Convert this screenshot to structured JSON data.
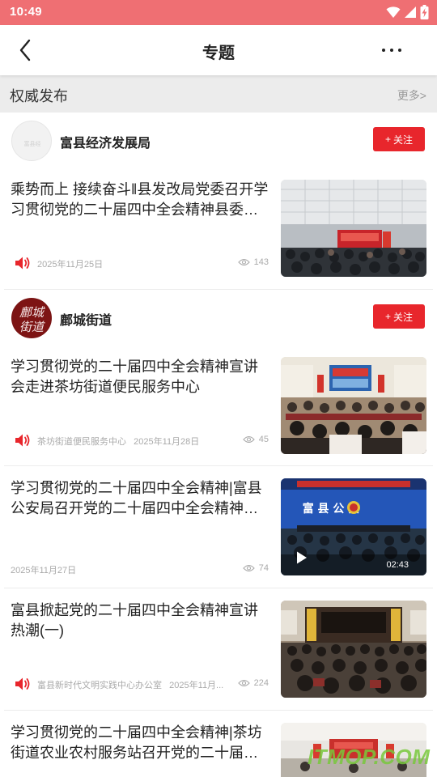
{
  "status_bar": {
    "time": "10:49"
  },
  "nav": {
    "title": "专题"
  },
  "section": {
    "title": "权威发布",
    "more": "更多>"
  },
  "accounts": [
    {
      "name": "富县经济发展局",
      "follow_label": "关注",
      "follow_plus": "+"
    },
    {
      "name": "鄜城街道",
      "follow_label": "关注",
      "follow_plus": "+",
      "logo_text": "鄜城街道"
    }
  ],
  "articles": [
    {
      "title": "乘势而上 接续奋斗‖县发改局党委召开学习贯彻党的二十届四中全会精神县委宣…",
      "source": "",
      "date": "2025年11月25日",
      "views": "143"
    },
    {
      "title": "学习贯彻党的二十届四中全会精神宣讲会走进茶坊街道便民服务中心",
      "source": "茶坊街道便民服务中心",
      "date": "2025年11月28日",
      "views": "45"
    },
    {
      "title": "学习贯彻党的二十届四中全会精神|富县公安局召开党的二十届四中全会精神宣…",
      "source": "",
      "date": "2025年11月27日",
      "views": "74",
      "duration": "02:43",
      "banner": "富 县 公 安"
    },
    {
      "title": "富县掀起党的二十届四中全会精神宣讲热潮(一)",
      "source": "富县新时代文明实践中心办公室",
      "date": "2025年11月...",
      "views": "224"
    },
    {
      "title": "学习贯彻党的二十届四中全会精神|茶坊街道农业农村服务站召开党的二十届四…"
    }
  ],
  "watermark": "ITMOP.COM",
  "colors": {
    "status_bar": "#ef6f73",
    "follow_button": "#e8262c",
    "speaker": "#e8262c"
  }
}
